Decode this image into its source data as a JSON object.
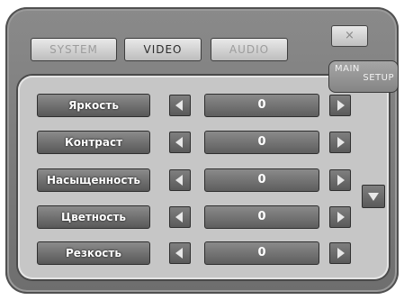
{
  "tabs": [
    {
      "label": "SYSTEM"
    },
    {
      "label": "VIDEO"
    },
    {
      "label": "AUDIO"
    }
  ],
  "active_tab": "VIDEO",
  "close_label": "×",
  "main_setup": {
    "line1": "MAIN",
    "line2": "SETUP"
  },
  "settings": [
    {
      "label": "Яркость",
      "value": "0"
    },
    {
      "label": "Контраст",
      "value": "0"
    },
    {
      "label": "Насыщенность",
      "value": "0"
    },
    {
      "label": "Цветность",
      "value": "0"
    },
    {
      "label": "Резкость",
      "value": "0"
    }
  ],
  "icons": {
    "decrease": "arrow-left-icon",
    "increase": "arrow-right-icon",
    "scroll": "arrow-down-icon",
    "close": "close-icon"
  }
}
